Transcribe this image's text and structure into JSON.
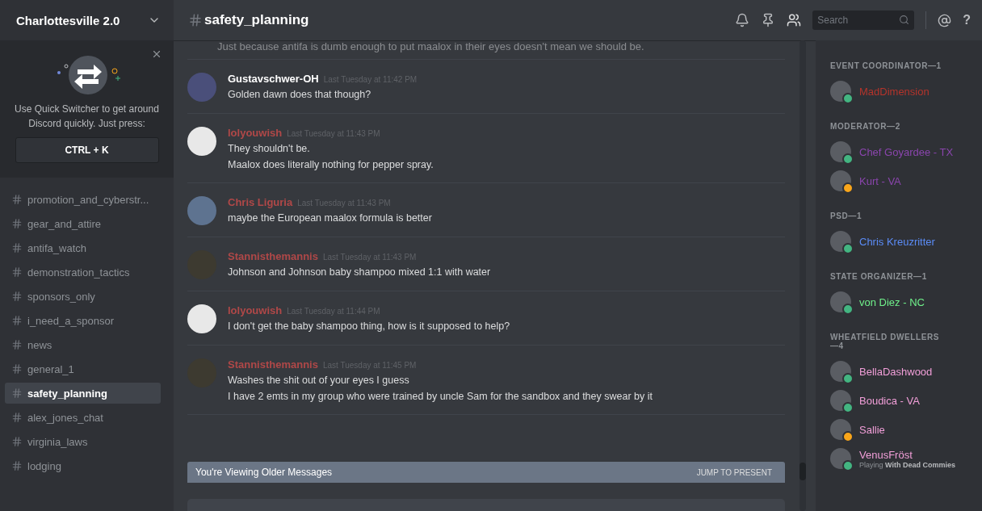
{
  "server": {
    "name": "Charlottesville 2.0"
  },
  "quick_switcher": {
    "text": "Use Quick Switcher to get around Discord quickly. Just press:",
    "shortcut": "CTRL + K"
  },
  "channels": [
    {
      "name": "promotion_and_cyberstr...",
      "selected": false
    },
    {
      "name": "gear_and_attire",
      "selected": false
    },
    {
      "name": "antifa_watch",
      "selected": false
    },
    {
      "name": "demonstration_tactics",
      "selected": false
    },
    {
      "name": "sponsors_only",
      "selected": false
    },
    {
      "name": "i_need_a_sponsor",
      "selected": false
    },
    {
      "name": "news",
      "selected": false
    },
    {
      "name": "general_1",
      "selected": false
    },
    {
      "name": "safety_planning",
      "selected": true
    },
    {
      "name": "alex_jones_chat",
      "selected": false
    },
    {
      "name": "virginia_laws",
      "selected": false
    },
    {
      "name": "lodging",
      "selected": false
    }
  ],
  "header": {
    "channel": "safety_planning",
    "search": {
      "placeholder": "Search"
    },
    "help": "?"
  },
  "top_line": "Just because antifa is dumb enough to put maalox in their eyes doesn't mean we should be.",
  "messages": [
    {
      "author": "Gustavschwer-OH",
      "color": "#ffffff",
      "time": "Last Tuesday at 11:42 PM",
      "lines": [
        "Golden dawn does that though?"
      ]
    },
    {
      "author": "lolyouwish",
      "color": "#b04848",
      "time": "Last Tuesday at 11:43 PM",
      "lines": [
        "They shouldn't be.",
        "Maalox does literally nothing for pepper spray."
      ]
    },
    {
      "author": "Chris Liguria",
      "color": "#b04848",
      "time": "Last Tuesday at 11:43 PM",
      "lines": [
        "maybe the European maalox formula is better"
      ]
    },
    {
      "author": "Stannisthemannis",
      "color": "#b04848",
      "time": "Last Tuesday at 11:43 PM",
      "lines": [
        "Johnson and Johnson baby shampoo mixed 1:1 with water"
      ]
    },
    {
      "author": "lolyouwish",
      "color": "#b04848",
      "time": "Last Tuesday at 11:44 PM",
      "lines": [
        "I don't get the baby shampoo thing, how is it supposed to help?"
      ]
    },
    {
      "author": "Stannisthemannis",
      "color": "#b04848",
      "time": "Last Tuesday at 11:45 PM",
      "lines": [
        "Washes the shit out of your eyes I guess",
        "I have 2 emts in my group who were trained by uncle Sam for the sandbox and they swear by it"
      ]
    }
  ],
  "older_bar": {
    "text": "You're Viewing Older Messages",
    "action": "JUMP TO PRESENT"
  },
  "member_groups": [
    {
      "title": "EVENT COORDINATOR—1",
      "members": [
        {
          "name": "MadDimension",
          "color": "#b5342b",
          "idle": false
        }
      ]
    },
    {
      "title": "MODERATOR—2",
      "members": [
        {
          "name": "Chef Goyardee - TX",
          "color": "#8a45ad",
          "idle": false
        },
        {
          "name": "Kurt - VA",
          "color": "#8a45ad",
          "idle": true
        }
      ]
    },
    {
      "title": "PSD—1",
      "members": [
        {
          "name": "Chris Kreuzritter",
          "color": "#5b8cf7",
          "idle": false
        }
      ]
    },
    {
      "title": "STATE ORGANIZER—1",
      "members": [
        {
          "name": "von Diez - NC",
          "color": "#6ff08a",
          "idle": false
        }
      ]
    },
    {
      "title": "WHEATFIELD DWELLERS—4",
      "members": [
        {
          "name": "BellaDashwood",
          "color": "#f29fd9",
          "idle": false
        },
        {
          "name": "Boudica - VA",
          "color": "#f29fd9",
          "idle": false
        },
        {
          "name": "Sallie",
          "color": "#f29fd9",
          "idle": true
        },
        {
          "name": "VenusFröst",
          "color": "#f29fd9",
          "idle": false,
          "activity": "Playing **With Dead Commies**"
        }
      ]
    }
  ]
}
